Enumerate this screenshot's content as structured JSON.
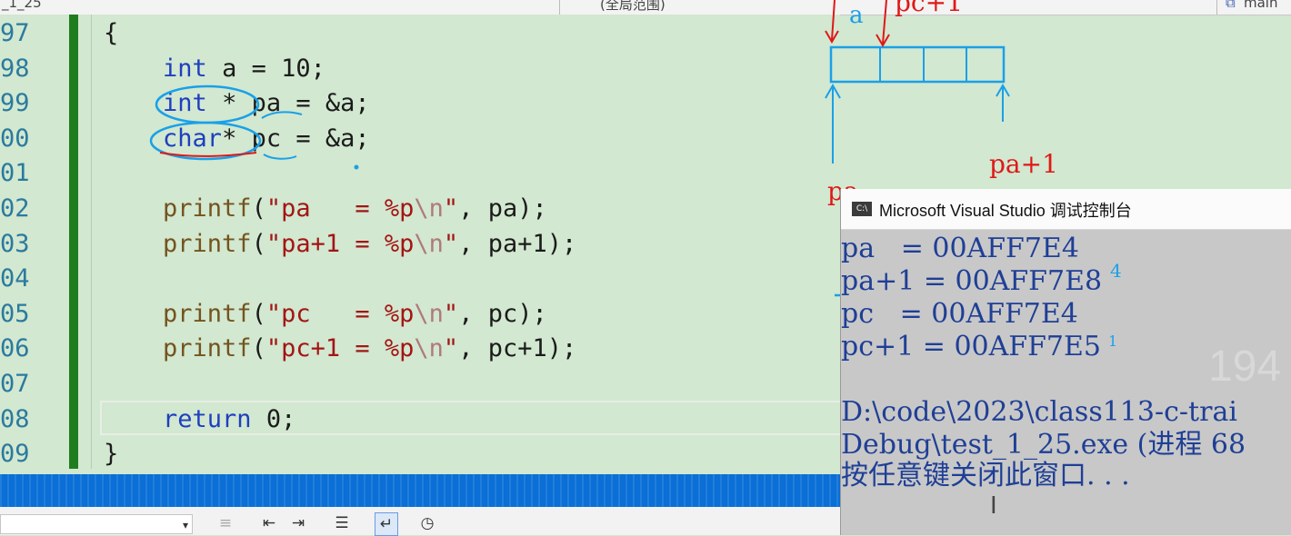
{
  "topbar": {
    "file_label": "_1_25",
    "scope_label": "(全局范围)",
    "func_label": "main"
  },
  "editor": {
    "line_numbers": [
      "97",
      "98",
      "99",
      "00",
      "01",
      "02",
      "03",
      "04",
      "05",
      "06",
      "07",
      "08",
      "09"
    ],
    "lines": [
      [
        {
          "t": "{",
          "c": ""
        }
      ],
      [
        {
          "t": "    ",
          "c": ""
        },
        {
          "t": "int",
          "c": "kw"
        },
        {
          "t": " a = 10;",
          "c": ""
        }
      ],
      [
        {
          "t": "    ",
          "c": ""
        },
        {
          "t": "int",
          "c": "kw"
        },
        {
          "t": " * pa = &a;",
          "c": ""
        }
      ],
      [
        {
          "t": "    ",
          "c": ""
        },
        {
          "t": "char",
          "c": "kw"
        },
        {
          "t": "* pc = &a;",
          "c": ""
        }
      ],
      [
        {
          "t": "",
          "c": ""
        }
      ],
      [
        {
          "t": "    ",
          "c": ""
        },
        {
          "t": "printf",
          "c": "fn"
        },
        {
          "t": "(",
          "c": ""
        },
        {
          "t": "\"pa   = %p",
          "c": "str"
        },
        {
          "t": "\\n",
          "c": "esc"
        },
        {
          "t": "\"",
          "c": "str"
        },
        {
          "t": ", pa);",
          "c": ""
        }
      ],
      [
        {
          "t": "    ",
          "c": ""
        },
        {
          "t": "printf",
          "c": "fn"
        },
        {
          "t": "(",
          "c": ""
        },
        {
          "t": "\"pa+1 = %p",
          "c": "str"
        },
        {
          "t": "\\n",
          "c": "esc"
        },
        {
          "t": "\"",
          "c": "str"
        },
        {
          "t": ", pa+1);",
          "c": ""
        }
      ],
      [
        {
          "t": "",
          "c": ""
        }
      ],
      [
        {
          "t": "    ",
          "c": ""
        },
        {
          "t": "printf",
          "c": "fn"
        },
        {
          "t": "(",
          "c": ""
        },
        {
          "t": "\"pc   = %p",
          "c": "str"
        },
        {
          "t": "\\n",
          "c": "esc"
        },
        {
          "t": "\"",
          "c": "str"
        },
        {
          "t": ", pc);",
          "c": ""
        }
      ],
      [
        {
          "t": "    ",
          "c": ""
        },
        {
          "t": "printf",
          "c": "fn"
        },
        {
          "t": "(",
          "c": ""
        },
        {
          "t": "\"pc+1 = %p",
          "c": "str"
        },
        {
          "t": "\\n",
          "c": "esc"
        },
        {
          "t": "\"",
          "c": "str"
        },
        {
          "t": ", pc+1);",
          "c": ""
        }
      ],
      [
        {
          "t": "",
          "c": ""
        }
      ],
      [
        {
          "t": "    ",
          "c": ""
        },
        {
          "t": "return",
          "c": "kw"
        },
        {
          "t": " 0;",
          "c": ""
        }
      ],
      [
        {
          "t": "}",
          "c": ""
        }
      ]
    ]
  },
  "annotations": {
    "label_a": "a",
    "label_pc_top": "pc+1",
    "label_pa": "pa",
    "label_pa1": "pa+1",
    "note_4": "4",
    "note_1": "1"
  },
  "console": {
    "title": "Microsoft Visual Studio 调试控制台",
    "icon": "C:\\",
    "output": [
      "pa   = 00AFF7E4",
      "pa+1 = 00AFF7E8",
      "pc   = 00AFF7E4",
      "pc+1 = 00AFF7E5"
    ],
    "path_line1": "D:\\code\\2023\\class113-c-trai",
    "path_line2": "Debug\\test_1_25.exe (进程 68",
    "prompt": "按任意键关闭此窗口. . .",
    "watermark": "194"
  },
  "colors": {
    "editor_bg": "#d2e8d0",
    "keyword": "#1f3fbf",
    "function": "#74531f",
    "string": "#a31515",
    "status_blue": "#0a6fd6",
    "annotation_red": "#e01818",
    "annotation_blue": "#1aa0e8",
    "console_text": "#1f3f96"
  },
  "toolbar_icons": [
    "dropdown-arrow-icon",
    "align-left-icon",
    "outdent-icon",
    "indent-icon",
    "comment-lines-icon",
    "word-wrap-icon",
    "history-clock-icon"
  ]
}
